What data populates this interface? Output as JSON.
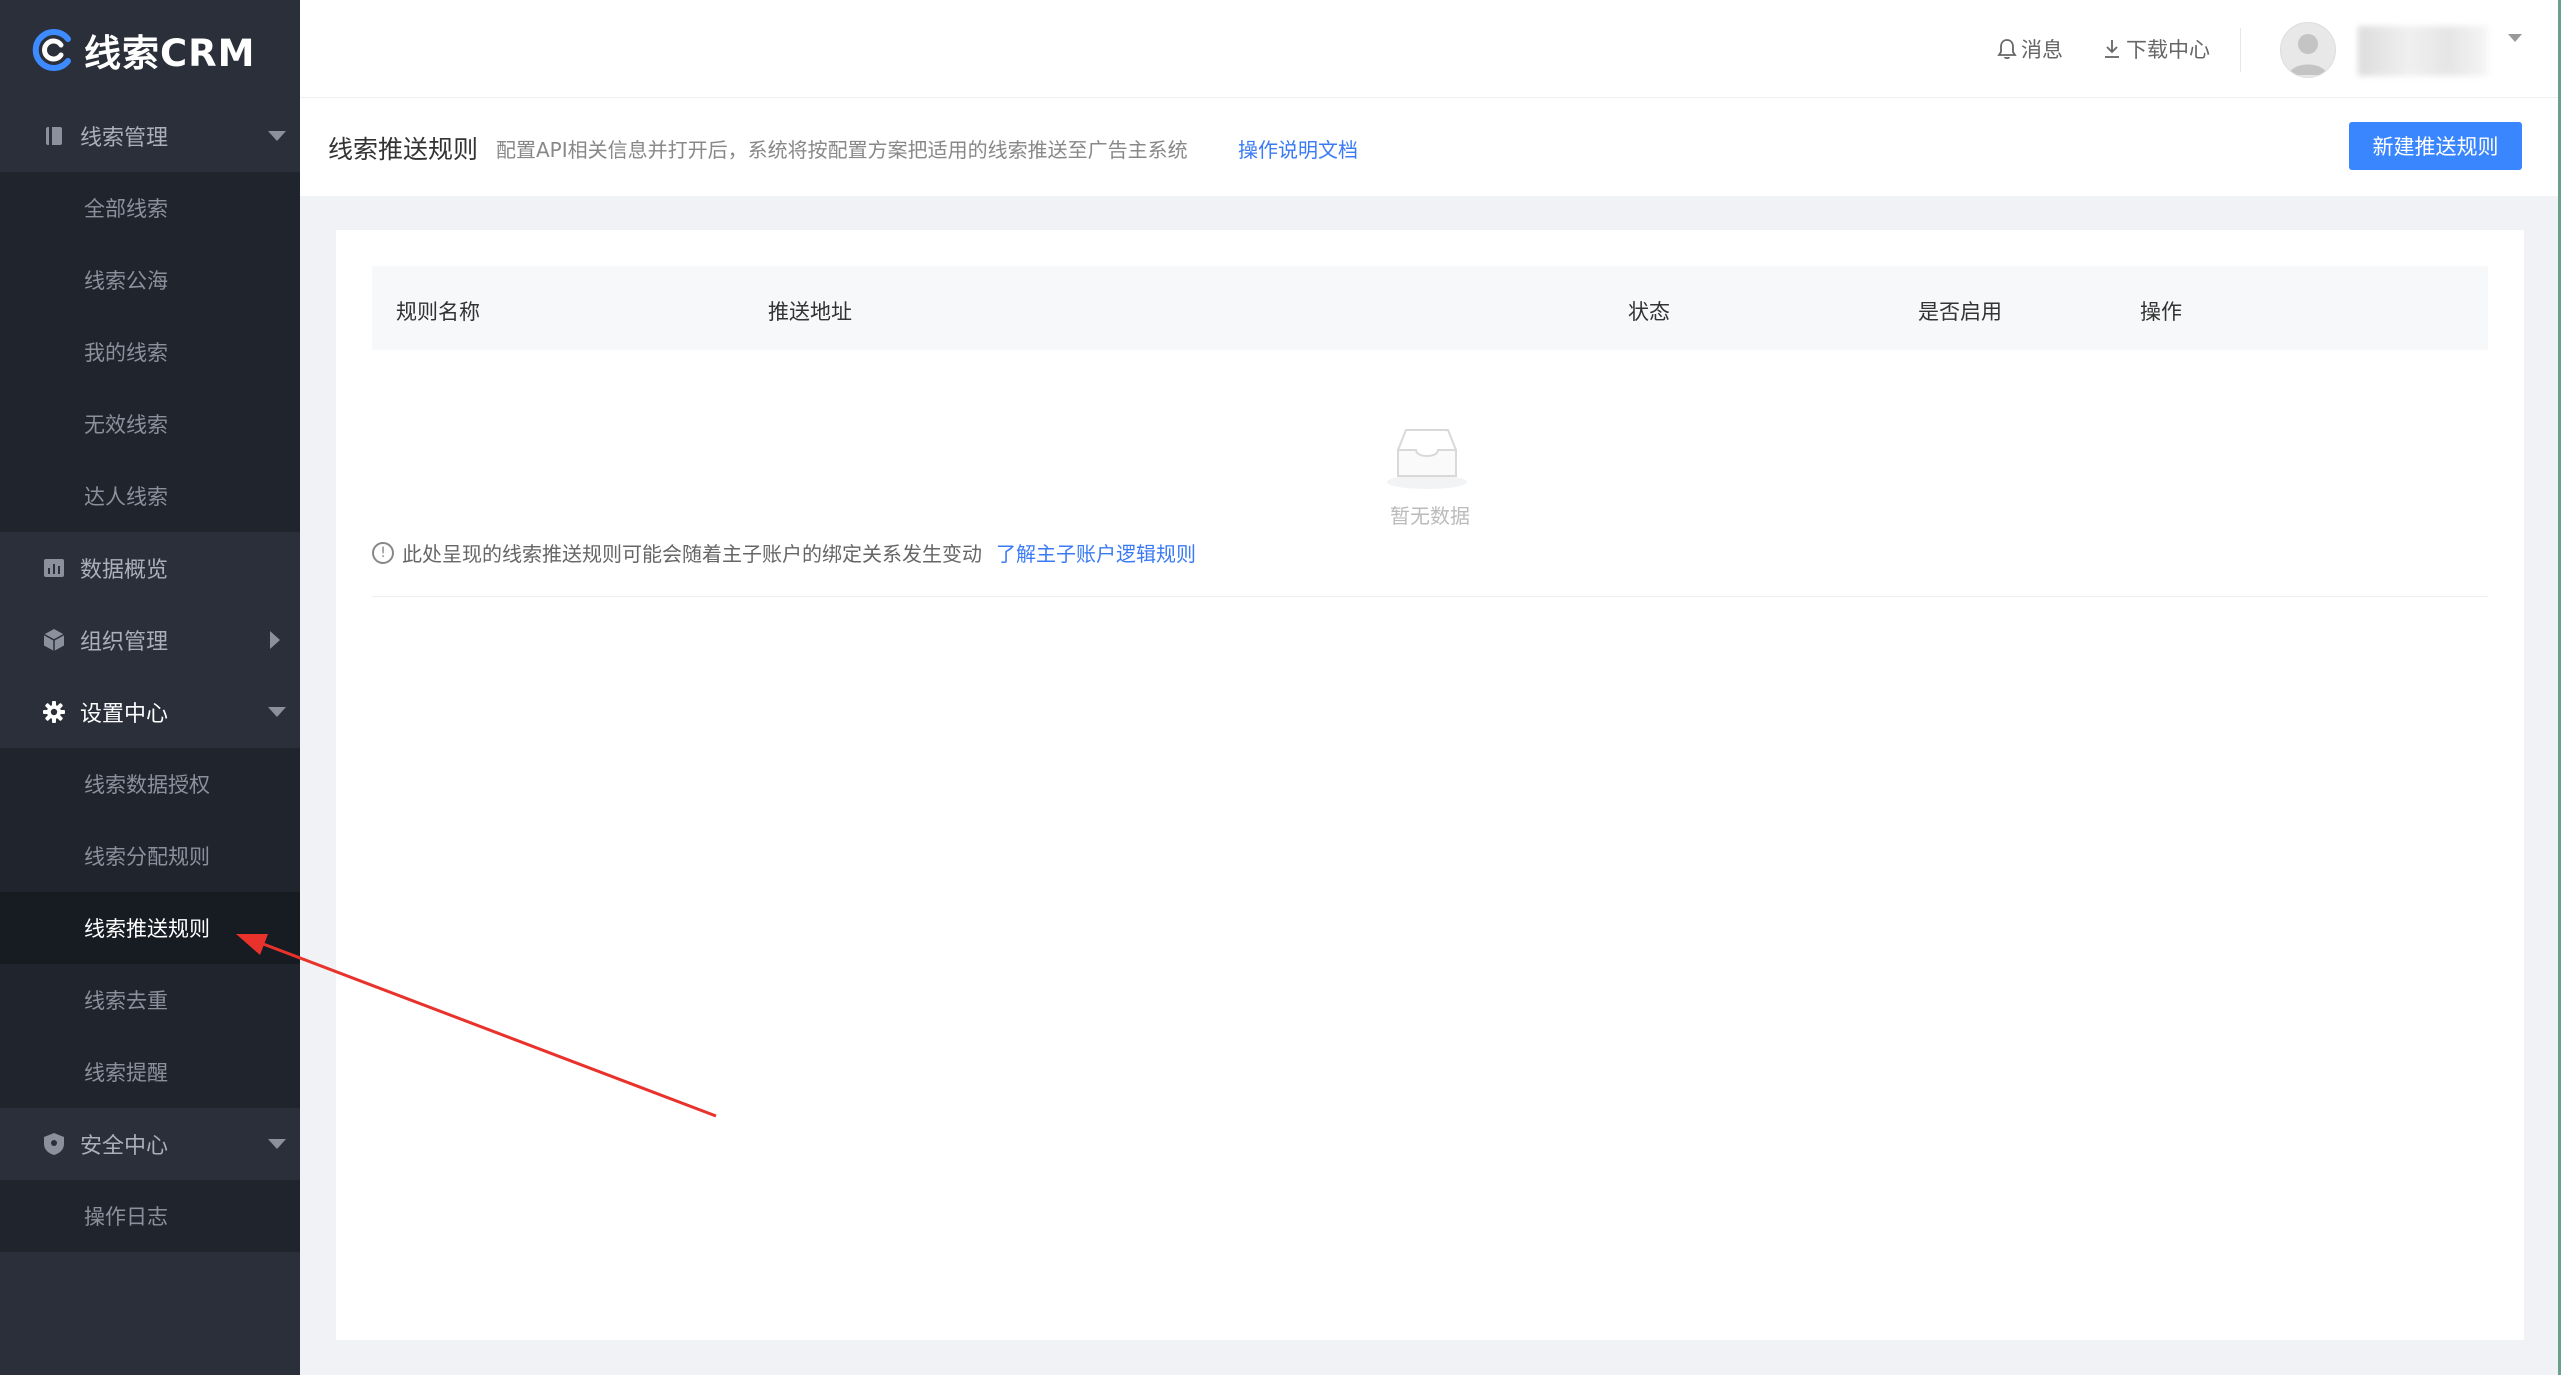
{
  "app": {
    "logo_text": "线索CRM"
  },
  "sidebar": {
    "groups": [
      {
        "label": "线索管理",
        "icon": "book-icon",
        "expanded": true,
        "items": [
          "全部线索",
          "线索公海",
          "我的线索",
          "无效线索",
          "达人线索"
        ]
      },
      {
        "label": "数据概览",
        "icon": "bar-chart-icon"
      },
      {
        "label": "组织管理",
        "icon": "cube-icon",
        "collapsed": true
      },
      {
        "label": "设置中心",
        "icon": "gear-icon",
        "expanded": true,
        "active": true,
        "items": [
          "线索数据授权",
          "线索分配规则",
          "线索推送规则",
          "线索去重",
          "线索提醒"
        ],
        "selected": "线索推送规则"
      },
      {
        "label": "安全中心",
        "icon": "shield-icon",
        "expanded": true,
        "items": [
          "操作日志"
        ]
      }
    ]
  },
  "topbar": {
    "messages_label": "消息",
    "download_label": "下载中心"
  },
  "page": {
    "title": "线索推送规则",
    "description": "配置API相关信息并打开后，系统将按配置方案把适用的线索推送至广告主系统",
    "doc_link": "操作说明文档",
    "new_button": "新建推送规则"
  },
  "table": {
    "columns": [
      "规则名称",
      "推送地址",
      "状态",
      "是否启用",
      "操作"
    ],
    "rows": [],
    "empty_text": "暂无数据"
  },
  "notice": {
    "text": "此处呈现的线索推送规则可能会随着主子账户的绑定关系发生变动",
    "link": "了解主子账户逻辑规则"
  },
  "colors": {
    "sidebar_bg": "#2a2f3a",
    "primary": "#3a86ff",
    "link": "#3a7bf5",
    "annotation_arrow": "#e8322b"
  }
}
